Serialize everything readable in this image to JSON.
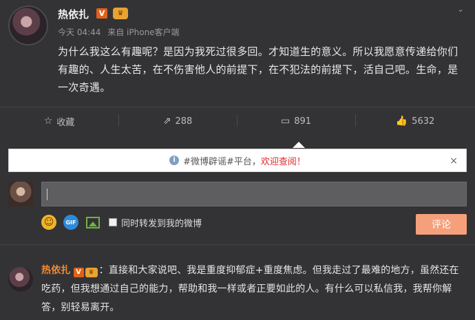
{
  "post": {
    "username": "热依扎",
    "verified_badge": "V",
    "vip_badge": "♛",
    "time": "今天 04:44",
    "source": "来自 iPhone客户端",
    "text": "为什么我这么有趣呢？是因为我死过很多回。才知道生的意义。所以我愿意传递给你们有趣的、人生太苦，在不伤害他人的前提下，在不犯法的前提下，活自己吧。生命，是一次奇遇。"
  },
  "actions": {
    "favorite": {
      "icon": "star-icon",
      "label": "收藏"
    },
    "repost": {
      "icon": "share-icon",
      "label": "288"
    },
    "comment": {
      "icon": "comment-icon",
      "label": "891"
    },
    "like": {
      "icon": "thumbs-up-icon",
      "label": "5632"
    }
  },
  "notice": {
    "text": "#微博辟谣#平台，",
    "link": "欢迎查阅！",
    "close": "×"
  },
  "comment_box": {
    "value": "",
    "forward_checkbox_label": "同时转发到我的微博",
    "submit_label": "评论",
    "gif_label": "GIF"
  },
  "reply": {
    "username": "热依扎",
    "verified_badge": "V",
    "vip_badge": "♛",
    "separator": "：",
    "text": "直接和大家说吧、我是重度抑郁症+重度焦虑。但我走过了最难的地方，虽然还在吃药，但我想通过自己的能力，帮助和我一样或者正要如此的人。有什么可以私信我，我帮你解答，别轻易离开。"
  },
  "colors": {
    "background": "#333335",
    "accent": "#f28b33",
    "submit": "#f5a07b",
    "notice_link": "#e0282e"
  }
}
